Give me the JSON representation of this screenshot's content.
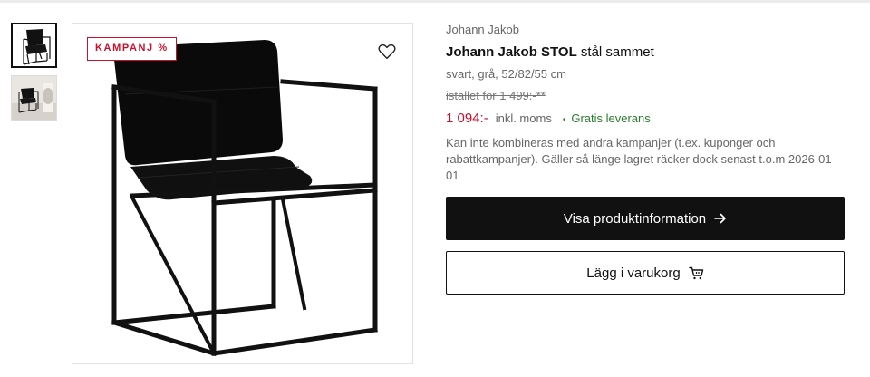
{
  "thumbnails": [
    {
      "icon": "chair-front-thumbnail",
      "active": true
    },
    {
      "icon": "chair-room-thumbnail",
      "active": false
    }
  ],
  "image": {
    "badge": "KAMPANJ %",
    "favorite_icon": "heart-icon"
  },
  "product": {
    "brand": "Johann Jakob",
    "title_bold": "Johann Jakob STOL",
    "title_rest": " stål sammet",
    "variant": "svart, grå, 52/82/55 cm",
    "old_price": "istället för 1 499:-**",
    "price": "1 094:-",
    "vat": "inkl. moms",
    "shipping_dot": "•",
    "shipping": "Gratis leverans",
    "note": "Kan inte kombineras med andra kampanjer (t.ex. kuponger och rabattkampanjer). Gäller så länge lagret räcker dock senast t.o.m 2026-01-01"
  },
  "buttons": {
    "info_label": "Visa produktinformation",
    "info_icon": "arrow-right-icon",
    "cart_label": "Lägg i varukorg",
    "cart_icon": "cart-icon"
  },
  "colors": {
    "accent_red": "#c8102e",
    "shipping_green": "#2a7d2e",
    "button_dark": "#111111"
  }
}
